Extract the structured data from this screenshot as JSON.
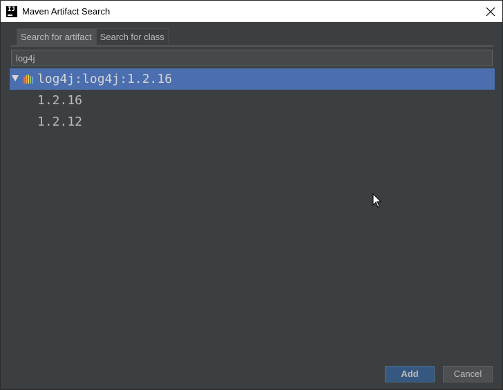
{
  "window": {
    "title": "Maven Artifact Search",
    "app_icon_text": "IJ"
  },
  "tabs": [
    {
      "label": "Search for artifact",
      "active": true
    },
    {
      "label": "Search for class",
      "active": false
    }
  ],
  "search": {
    "value": "log4j",
    "placeholder": ""
  },
  "results": {
    "group": {
      "label": "log4j:log4j:1.2.16",
      "expanded": true,
      "icon": "maven-icon"
    },
    "versions": [
      "1.2.16",
      "1.2.12"
    ]
  },
  "buttons": {
    "add_label": "Add",
    "cancel_label": "Cancel"
  },
  "colors": {
    "background": "#3c3f41",
    "selection": "#4b6eaf",
    "default_button": "#365880"
  }
}
